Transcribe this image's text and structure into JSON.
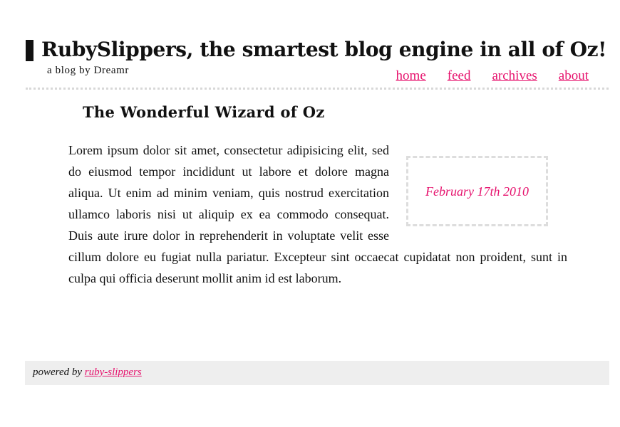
{
  "header": {
    "site_title": "RubySlippers, the smartest blog engine in all of Oz!",
    "tagline": "a blog by Dreamr"
  },
  "nav": {
    "items": [
      {
        "label": "home"
      },
      {
        "label": "feed"
      },
      {
        "label": "archives"
      },
      {
        "label": "about"
      }
    ]
  },
  "post": {
    "title": "The Wonderful Wizard of Oz",
    "date": "February 17th 2010",
    "body": "Lorem ipsum dolor sit amet, consectetur adipisicing elit, sed do eiusmod tempor incididunt ut labore et dolore magna aliqua. Ut enim ad minim veniam, quis nostrud exercitation ullamco laboris nisi ut aliquip ex ea commodo consequat. Duis aute irure dolor in reprehenderit in voluptate velit esse cillum dolore eu fugiat nulla pariatur. Excepteur sint occaecat cupidatat non proident, sunt in culpa qui officia deserunt mollit anim id est laborum."
  },
  "footer": {
    "powered_by": "powered by",
    "link_label": "ruby-slippers"
  },
  "colors": {
    "accent": "#e6126d",
    "text": "#111111",
    "footer_bg": "#eeeeee",
    "divider": "#d8d8d8"
  }
}
